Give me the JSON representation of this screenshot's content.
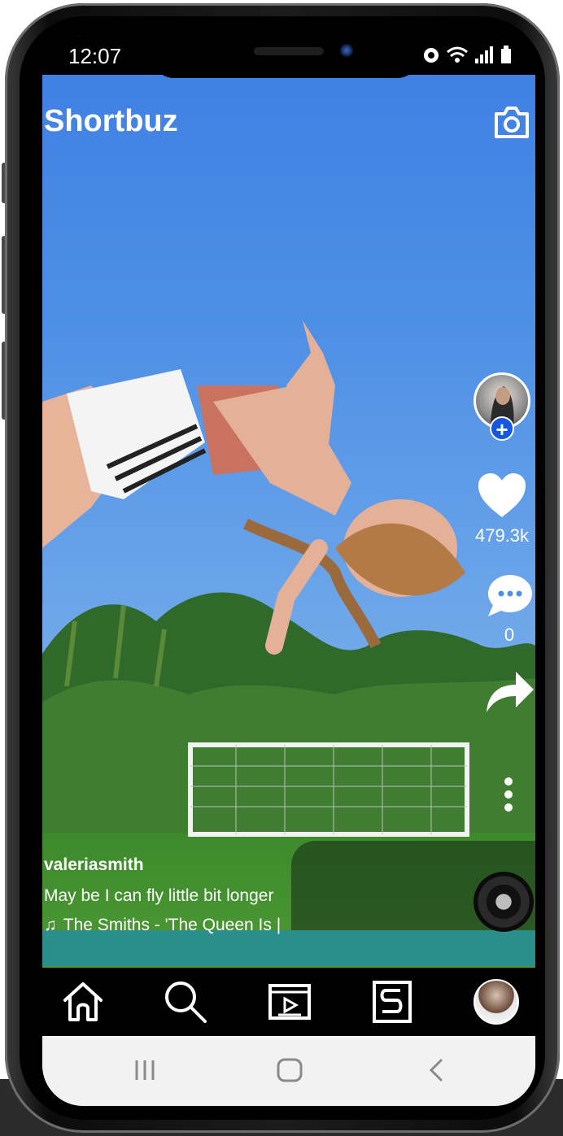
{
  "status_bar": {
    "time": "12:07",
    "icons": [
      "alarm-icon",
      "wifi-icon",
      "signal-icon",
      "battery-icon"
    ]
  },
  "header": {
    "title": "Shortbuz",
    "camera_icon": "camera-icon"
  },
  "actions": {
    "like_count": "479.3k",
    "comment_count": "0",
    "follow_symbol": "+"
  },
  "video": {
    "username": "valeriasmith",
    "caption": "May be I can fly little  bit  longer",
    "music": "The Smiths - 'The Queen Is |",
    "music_icon": "♫"
  },
  "bottom_nav": {
    "items": [
      "home-icon",
      "search-icon",
      "video-icon",
      "shorts-icon",
      "profile-avatar"
    ]
  },
  "system_nav": {
    "items": [
      "recent-apps-icon",
      "home-button-icon",
      "back-icon"
    ]
  },
  "colors": {
    "sky": "#4f8fe0",
    "follow_badge": "#1457e0",
    "nav_bg": "#000000",
    "system_nav_bg": "#f2f2f2"
  }
}
